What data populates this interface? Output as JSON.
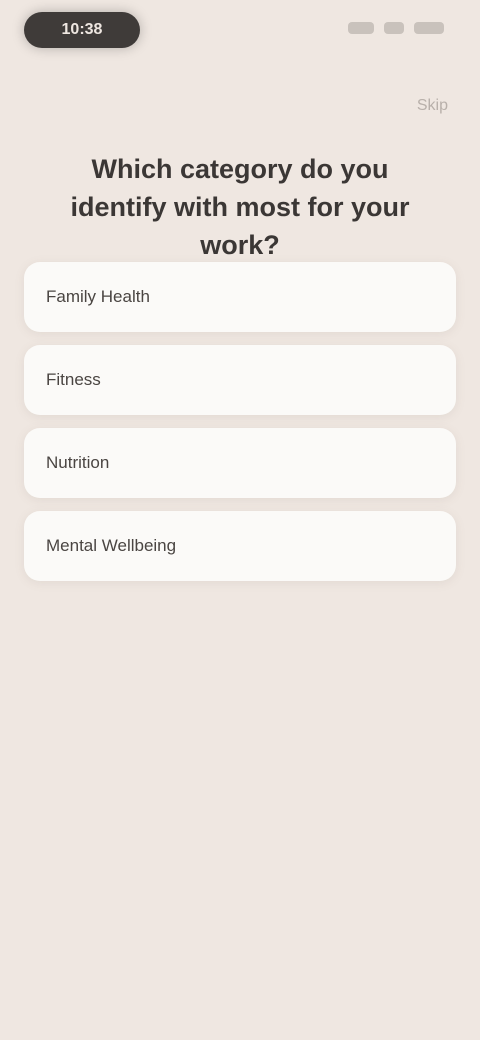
{
  "status_bar": {
    "time": "10:38",
    "icons": [
      "signal-icon",
      "wifi-icon",
      "battery-icon"
    ]
  },
  "header": {
    "skip_label": "Skip"
  },
  "question": {
    "text": "Which category do you identify with most for your work?"
  },
  "options": [
    {
      "label": "Family Health"
    },
    {
      "label": "Fitness"
    },
    {
      "label": "Nutrition"
    },
    {
      "label": "Mental Wellbeing"
    }
  ],
  "colors": {
    "background": "#efe7e1",
    "card": "#fbfaf8",
    "text": "#3b3735",
    "muted": "#b8b0aa",
    "pill": "#3f3b39"
  }
}
